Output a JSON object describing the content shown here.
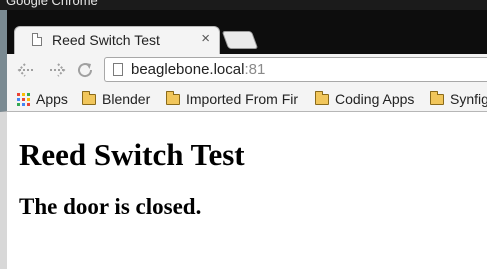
{
  "os_window": {
    "title": "Google Chrome"
  },
  "tab": {
    "title": "Reed Switch Test",
    "close_glyph": "×"
  },
  "toolbar": {
    "back_icon": "back-arrow-icon",
    "forward_icon": "forward-arrow-icon",
    "reload_icon": "reload-icon",
    "address": {
      "host": "beaglebone.local",
      "port": ":81"
    }
  },
  "bookmarks": [
    {
      "label": "Apps",
      "icon": "apps-grid-icon"
    },
    {
      "label": "Blender",
      "icon": "folder-icon"
    },
    {
      "label": "Imported From Fir",
      "icon": "folder-icon"
    },
    {
      "label": "Coding Apps",
      "icon": "folder-icon"
    },
    {
      "label": "Synfig",
      "icon": "folder-icon"
    }
  ],
  "page": {
    "heading": "Reed Switch Test",
    "status": "The door is closed."
  },
  "colors": {
    "apps_grid": [
      "#ea4335",
      "#fbbc05",
      "#34a853",
      "#4285f4",
      "#ea4335",
      "#fbbc05",
      "#34a853",
      "#4285f4",
      "#ea4335"
    ],
    "folder": "#f1c65b"
  }
}
